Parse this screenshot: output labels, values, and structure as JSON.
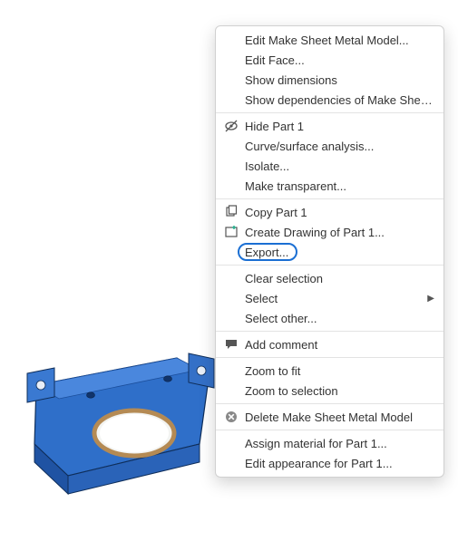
{
  "menu": {
    "items": [
      {
        "label": "Edit Make Sheet Metal Model..."
      },
      {
        "label": "Edit Face..."
      },
      {
        "label": "Show dimensions"
      },
      {
        "label": "Show dependencies of Make Sheet M..."
      }
    ],
    "items2": [
      {
        "label": "Hide Part 1"
      },
      {
        "label": "Curve/surface analysis..."
      },
      {
        "label": "Isolate..."
      },
      {
        "label": "Make transparent..."
      }
    ],
    "items3": [
      {
        "label": "Copy Part 1"
      },
      {
        "label": "Create Drawing of Part 1..."
      },
      {
        "label": "Export..."
      }
    ],
    "items4": [
      {
        "label": "Clear selection"
      },
      {
        "label": "Select"
      },
      {
        "label": "Select other..."
      }
    ],
    "items5": [
      {
        "label": "Add comment"
      }
    ],
    "items6": [
      {
        "label": "Zoom to fit"
      },
      {
        "label": "Zoom to selection"
      }
    ],
    "items7": [
      {
        "label": "Delete Make Sheet Metal Model"
      }
    ],
    "items8": [
      {
        "label": "Assign material for Part 1..."
      },
      {
        "label": "Edit appearance for Part 1..."
      }
    ]
  }
}
